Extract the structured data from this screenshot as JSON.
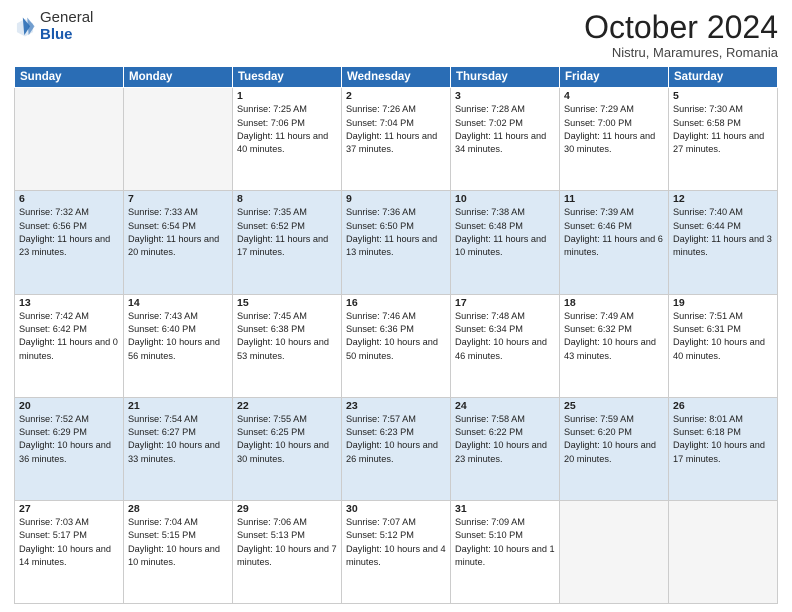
{
  "logo": {
    "general": "General",
    "blue": "Blue"
  },
  "title": "October 2024",
  "subtitle": "Nistru, Maramures, Romania",
  "days_of_week": [
    "Sunday",
    "Monday",
    "Tuesday",
    "Wednesday",
    "Thursday",
    "Friday",
    "Saturday"
  ],
  "weeks": [
    [
      {
        "day": "",
        "content": ""
      },
      {
        "day": "",
        "content": ""
      },
      {
        "day": "1",
        "content": "Sunrise: 7:25 AM\nSunset: 7:06 PM\nDaylight: 11 hours and 40 minutes."
      },
      {
        "day": "2",
        "content": "Sunrise: 7:26 AM\nSunset: 7:04 PM\nDaylight: 11 hours and 37 minutes."
      },
      {
        "day": "3",
        "content": "Sunrise: 7:28 AM\nSunset: 7:02 PM\nDaylight: 11 hours and 34 minutes."
      },
      {
        "day": "4",
        "content": "Sunrise: 7:29 AM\nSunset: 7:00 PM\nDaylight: 11 hours and 30 minutes."
      },
      {
        "day": "5",
        "content": "Sunrise: 7:30 AM\nSunset: 6:58 PM\nDaylight: 11 hours and 27 minutes."
      }
    ],
    [
      {
        "day": "6",
        "content": "Sunrise: 7:32 AM\nSunset: 6:56 PM\nDaylight: 11 hours and 23 minutes."
      },
      {
        "day": "7",
        "content": "Sunrise: 7:33 AM\nSunset: 6:54 PM\nDaylight: 11 hours and 20 minutes."
      },
      {
        "day": "8",
        "content": "Sunrise: 7:35 AM\nSunset: 6:52 PM\nDaylight: 11 hours and 17 minutes."
      },
      {
        "day": "9",
        "content": "Sunrise: 7:36 AM\nSunset: 6:50 PM\nDaylight: 11 hours and 13 minutes."
      },
      {
        "day": "10",
        "content": "Sunrise: 7:38 AM\nSunset: 6:48 PM\nDaylight: 11 hours and 10 minutes."
      },
      {
        "day": "11",
        "content": "Sunrise: 7:39 AM\nSunset: 6:46 PM\nDaylight: 11 hours and 6 minutes."
      },
      {
        "day": "12",
        "content": "Sunrise: 7:40 AM\nSunset: 6:44 PM\nDaylight: 11 hours and 3 minutes."
      }
    ],
    [
      {
        "day": "13",
        "content": "Sunrise: 7:42 AM\nSunset: 6:42 PM\nDaylight: 11 hours and 0 minutes."
      },
      {
        "day": "14",
        "content": "Sunrise: 7:43 AM\nSunset: 6:40 PM\nDaylight: 10 hours and 56 minutes."
      },
      {
        "day": "15",
        "content": "Sunrise: 7:45 AM\nSunset: 6:38 PM\nDaylight: 10 hours and 53 minutes."
      },
      {
        "day": "16",
        "content": "Sunrise: 7:46 AM\nSunset: 6:36 PM\nDaylight: 10 hours and 50 minutes."
      },
      {
        "day": "17",
        "content": "Sunrise: 7:48 AM\nSunset: 6:34 PM\nDaylight: 10 hours and 46 minutes."
      },
      {
        "day": "18",
        "content": "Sunrise: 7:49 AM\nSunset: 6:32 PM\nDaylight: 10 hours and 43 minutes."
      },
      {
        "day": "19",
        "content": "Sunrise: 7:51 AM\nSunset: 6:31 PM\nDaylight: 10 hours and 40 minutes."
      }
    ],
    [
      {
        "day": "20",
        "content": "Sunrise: 7:52 AM\nSunset: 6:29 PM\nDaylight: 10 hours and 36 minutes."
      },
      {
        "day": "21",
        "content": "Sunrise: 7:54 AM\nSunset: 6:27 PM\nDaylight: 10 hours and 33 minutes."
      },
      {
        "day": "22",
        "content": "Sunrise: 7:55 AM\nSunset: 6:25 PM\nDaylight: 10 hours and 30 minutes."
      },
      {
        "day": "23",
        "content": "Sunrise: 7:57 AM\nSunset: 6:23 PM\nDaylight: 10 hours and 26 minutes."
      },
      {
        "day": "24",
        "content": "Sunrise: 7:58 AM\nSunset: 6:22 PM\nDaylight: 10 hours and 23 minutes."
      },
      {
        "day": "25",
        "content": "Sunrise: 7:59 AM\nSunset: 6:20 PM\nDaylight: 10 hours and 20 minutes."
      },
      {
        "day": "26",
        "content": "Sunrise: 8:01 AM\nSunset: 6:18 PM\nDaylight: 10 hours and 17 minutes."
      }
    ],
    [
      {
        "day": "27",
        "content": "Sunrise: 7:03 AM\nSunset: 5:17 PM\nDaylight: 10 hours and 14 minutes."
      },
      {
        "day": "28",
        "content": "Sunrise: 7:04 AM\nSunset: 5:15 PM\nDaylight: 10 hours and 10 minutes."
      },
      {
        "day": "29",
        "content": "Sunrise: 7:06 AM\nSunset: 5:13 PM\nDaylight: 10 hours and 7 minutes."
      },
      {
        "day": "30",
        "content": "Sunrise: 7:07 AM\nSunset: 5:12 PM\nDaylight: 10 hours and 4 minutes."
      },
      {
        "day": "31",
        "content": "Sunrise: 7:09 AM\nSunset: 5:10 PM\nDaylight: 10 hours and 1 minute."
      },
      {
        "day": "",
        "content": ""
      },
      {
        "day": "",
        "content": ""
      }
    ]
  ]
}
